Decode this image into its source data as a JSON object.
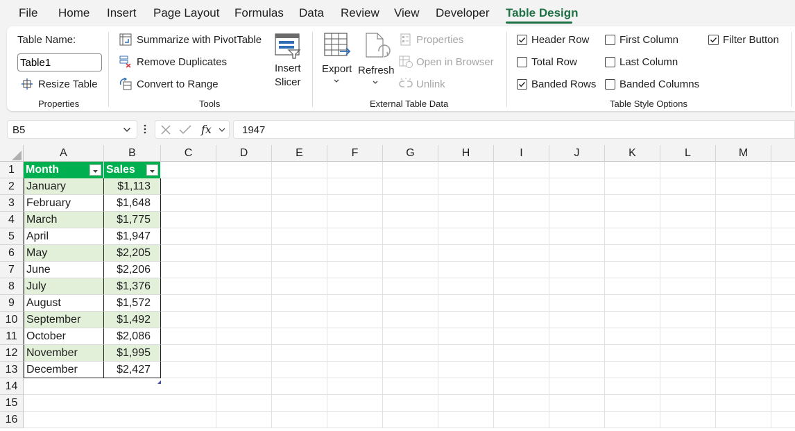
{
  "menu": {
    "items": [
      "File",
      "Home",
      "Insert",
      "Page Layout",
      "Formulas",
      "Data",
      "Review",
      "View",
      "Developer",
      "Table Design"
    ],
    "active": "Table Design"
  },
  "ribbon": {
    "properties": {
      "table_name_label": "Table Name:",
      "table_name_value": "Table1",
      "resize_label": "Resize Table",
      "group_label": "Properties"
    },
    "tools": {
      "summarize_label": "Summarize with PivotTable",
      "remove_dup_label": "Remove Duplicates",
      "convert_label": "Convert to Range",
      "slicer_label_1": "Insert",
      "slicer_label_2": "Slicer",
      "group_label": "Tools"
    },
    "external": {
      "export_label": "Export",
      "refresh_label": "Refresh",
      "properties_label": "Properties",
      "open_browser_label": "Open in Browser",
      "unlink_label": "Unlink",
      "group_label": "External Table Data"
    },
    "style_options": {
      "header_row": {
        "label": "Header Row",
        "checked": true
      },
      "total_row": {
        "label": "Total Row",
        "checked": false
      },
      "banded_rows": {
        "label": "Banded Rows",
        "checked": true
      },
      "first_column": {
        "label": "First Column",
        "checked": false
      },
      "last_column": {
        "label": "Last Column",
        "checked": false
      },
      "banded_columns": {
        "label": "Banded Columns",
        "checked": false
      },
      "filter_button": {
        "label": "Filter Button",
        "checked": true
      },
      "group_label": "Table Style Options"
    }
  },
  "formula_bar": {
    "name_box": "B5",
    "formula": "1947",
    "fx": "fx"
  },
  "sheet": {
    "columns": [
      "A",
      "B",
      "C",
      "D",
      "E",
      "F",
      "G",
      "H",
      "I",
      "J",
      "K",
      "L",
      "M"
    ],
    "rows": [
      "1",
      "2",
      "3",
      "4",
      "5",
      "6",
      "7",
      "8",
      "9",
      "10",
      "11",
      "12",
      "13",
      "14",
      "15",
      "16"
    ],
    "table": {
      "headers": [
        "Month",
        "Sales"
      ],
      "data": [
        [
          "January",
          "$1,113"
        ],
        [
          "February",
          "$1,648"
        ],
        [
          "March",
          "$1,775"
        ],
        [
          "April",
          "$1,947"
        ],
        [
          "May",
          "$2,205"
        ],
        [
          "June",
          "$2,206"
        ],
        [
          "July",
          "$1,376"
        ],
        [
          "August",
          "$1,572"
        ],
        [
          "September",
          "$1,492"
        ],
        [
          "October",
          "$2,086"
        ],
        [
          "November",
          "$1,995"
        ],
        [
          "December",
          "$2,427"
        ]
      ]
    }
  },
  "colors": {
    "accent": "#1e7145",
    "table_header": "#00b050",
    "band": "#e2f0d9"
  }
}
